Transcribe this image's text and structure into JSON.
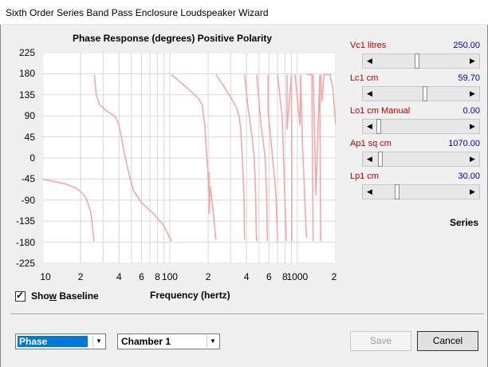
{
  "window": {
    "title": "Sixth Order Series Band Pass Enclosure Loudspeaker Wizard"
  },
  "chart": {
    "title": "Phase Response (degrees)   Positive Polarity",
    "xlabel": "Frequency (hertz)"
  },
  "chart_data": {
    "type": "line",
    "title": "Phase Response (degrees)   Positive Polarity",
    "xlabel": "Frequency (hertz)",
    "ylabel": "",
    "x_scale": "log",
    "xlim": [
      10,
      2000
    ],
    "ylim": [
      -225,
      225
    ],
    "y_ticks": [
      "225",
      "180",
      "135",
      "90",
      "45",
      "0",
      "-45",
      "-90",
      "-135",
      "-180",
      "-225"
    ],
    "x_ticks": [
      "10",
      "2",
      "4",
      "6",
      "8",
      "100",
      "2",
      "4",
      "6",
      "8",
      "1000",
      "2"
    ],
    "grid": true,
    "series": [
      {
        "color": "#f4a8a8",
        "x": [
          10,
          15,
          18,
          20,
          22,
          24,
          25.5,
          25.6,
          26.5,
          28,
          32,
          36,
          38,
          40,
          42,
          44,
          48,
          52,
          60,
          75,
          90,
          103,
          103.1,
          130,
          150,
          170,
          180,
          188,
          195,
          200,
          202,
          203,
          204,
          207,
          215,
          222,
          225,
          228,
          230,
          230.1,
          270,
          300,
          330,
          350,
          360,
          368,
          375,
          380,
          384,
          386,
          386.1,
          410,
          440,
          460,
          470,
          476,
          480,
          480.1,
          520,
          560,
          575,
          582,
          590,
          590.1,
          640,
          680,
          700,
          700.1,
          760,
          820,
          830,
          830.1,
          900,
          905,
          905.1,
          960,
          1050,
          1060,
          1100,
          1180,
          1190,
          1300,
          1330,
          1335,
          1400,
          1500,
          1525,
          1530,
          1560,
          1620,
          1700,
          1800,
          1900,
          2000
        ],
        "values": [
          -45,
          -55,
          -63,
          -72,
          -85,
          -115,
          -178,
          178,
          135,
          115,
          100,
          92,
          85,
          70,
          40,
          10,
          -35,
          -70,
          -95,
          -120,
          -145,
          -178,
          178,
          155,
          140,
          125,
          112,
          70,
          5,
          -40,
          -70,
          -30,
          -120,
          -60,
          -95,
          -130,
          -150,
          -165,
          -175,
          178,
          150,
          130,
          110,
          90,
          60,
          20,
          -30,
          -70,
          -110,
          -175,
          178,
          110,
          50,
          0,
          -70,
          -150,
          -178,
          178,
          70,
          0,
          -80,
          -178,
          178,
          100,
          0,
          -80,
          -178,
          178,
          90,
          -178,
          178,
          60,
          178,
          0,
          -178,
          178,
          70,
          178,
          20,
          -170,
          178,
          178,
          -178,
          178,
          -80,
          178,
          -178,
          178,
          120,
          178,
          178,
          178,
          150,
          70
        ]
      }
    ]
  },
  "controls": {
    "show_baseline": {
      "label_pre": "Sho",
      "label_u": "w",
      "label_post": " Baseline",
      "checked_mark": "✓"
    },
    "series_label": "Series"
  },
  "params": [
    {
      "label": "Vc1  litres",
      "value": "250.00",
      "position": 0.45
    },
    {
      "label": "Lc1  cm",
      "value": "59.70",
      "position": 0.55
    },
    {
      "label": "Lo1  cm  Manual",
      "value": "0.00",
      "position": 0.0
    },
    {
      "label": "Ap1  sq cm",
      "value": "1070.00",
      "position": 0.02
    },
    {
      "label": "Lp1  cm",
      "value": "30.00",
      "position": 0.22
    }
  ],
  "bottom": {
    "plot_select": "Phase",
    "chamber_select": "Chamber 1",
    "save_label": "Save",
    "cancel_label": "Cancel"
  },
  "colors": {
    "trace": "#f4a8a8",
    "grid": "#d8d8d8",
    "param_label": "#c00000",
    "param_value": "#0000c8"
  }
}
